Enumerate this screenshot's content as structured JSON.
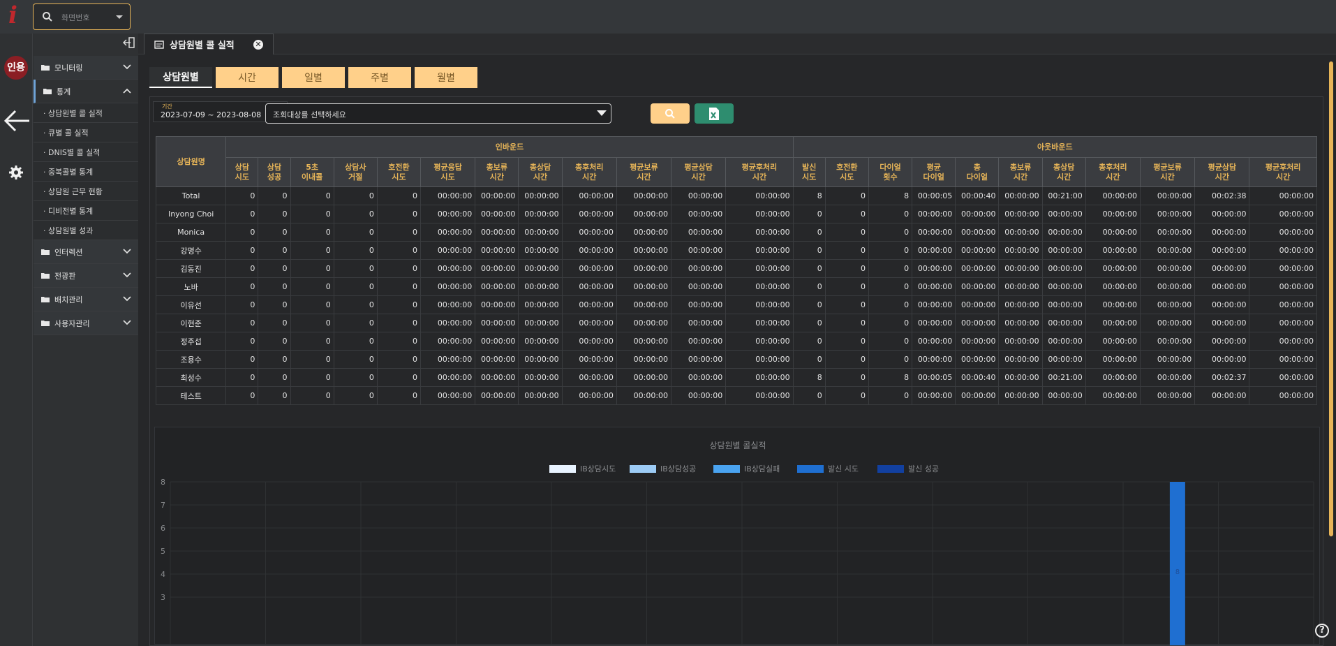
{
  "app": {
    "logo_text": "i",
    "search_placeholder": "화면번호"
  },
  "rail": {
    "avatar_text": "인용"
  },
  "sidebar": {
    "groups": [
      {
        "label": "모니터링",
        "open": false
      },
      {
        "label": "통계",
        "open": true,
        "items": [
          "· 상담원별 콜 실적",
          "· 큐별 콜 실적",
          "· DNIS별 콜 실적",
          "· 중복콜별 통계",
          "· 상담원 근무 현황",
          "· 디비전별 통계",
          "· 상담원별 성과"
        ]
      },
      {
        "label": "인터렉션",
        "open": false
      },
      {
        "label": "전광판",
        "open": false
      },
      {
        "label": "배치관리",
        "open": false
      },
      {
        "label": "사용자관리",
        "open": false
      }
    ]
  },
  "page_tab": {
    "label": "상담원별 콜 실적",
    "close": "✕"
  },
  "sub_tabs": [
    "상담원별",
    "시간",
    "일별",
    "주별",
    "월별"
  ],
  "filters": {
    "period_label": "기간",
    "period_value": "2023-07-09  ~  2023-08-08",
    "target_placeholder": "조회대상를 선택하세요"
  },
  "table": {
    "name_header": "상담원명",
    "inbound_header": "인바운드",
    "outbound_header": "아웃바운드",
    "inbound_cols": [
      "상담\n시도",
      "상담\n성공",
      "5초\n이내콜",
      "상담사\n거절",
      "호전환\n시도",
      "평균응답\n시도",
      "총보류\n시간",
      "총상담\n시간",
      "총후처리\n시간",
      "평균보류\n시간",
      "평균상담\n시간",
      "평균후처리\n시간"
    ],
    "outbound_cols": [
      "발신\n시도",
      "호전환\n시도",
      "다이얼\n횟수",
      "평균\n다이얼",
      "총\n다이얼",
      "총보류\n시간",
      "총상담\n시간",
      "총후처리\n시간",
      "평균보류\n시간",
      "평균상담\n시간",
      "평균후처리\n시간"
    ],
    "rows": [
      {
        "name": "Total",
        "values": [
          "0",
          "0",
          "0",
          "0",
          "0",
          "00:00:00",
          "00:00:00",
          "00:00:00",
          "00:00:00",
          "00:00:00",
          "00:00:00",
          "00:00:00",
          "8",
          "0",
          "8",
          "00:00:05",
          "00:00:40",
          "00:00:00",
          "00:21:00",
          "00:00:00",
          "00:00:00",
          "00:02:38",
          "00:00:00"
        ]
      },
      {
        "name": "Inyong Choi",
        "values": [
          "0",
          "0",
          "0",
          "0",
          "0",
          "00:00:00",
          "00:00:00",
          "00:00:00",
          "00:00:00",
          "00:00:00",
          "00:00:00",
          "00:00:00",
          "0",
          "0",
          "0",
          "00:00:00",
          "00:00:00",
          "00:00:00",
          "00:00:00",
          "00:00:00",
          "00:00:00",
          "00:00:00",
          "00:00:00"
        ]
      },
      {
        "name": "Monica",
        "values": [
          "0",
          "0",
          "0",
          "0",
          "0",
          "00:00:00",
          "00:00:00",
          "00:00:00",
          "00:00:00",
          "00:00:00",
          "00:00:00",
          "00:00:00",
          "0",
          "0",
          "0",
          "00:00:00",
          "00:00:00",
          "00:00:00",
          "00:00:00",
          "00:00:00",
          "00:00:00",
          "00:00:00",
          "00:00:00"
        ]
      },
      {
        "name": "강명수",
        "values": [
          "0",
          "0",
          "0",
          "0",
          "0",
          "00:00:00",
          "00:00:00",
          "00:00:00",
          "00:00:00",
          "00:00:00",
          "00:00:00",
          "00:00:00",
          "0",
          "0",
          "0",
          "00:00:00",
          "00:00:00",
          "00:00:00",
          "00:00:00",
          "00:00:00",
          "00:00:00",
          "00:00:00",
          "00:00:00"
        ]
      },
      {
        "name": "김동진",
        "values": [
          "0",
          "0",
          "0",
          "0",
          "0",
          "00:00:00",
          "00:00:00",
          "00:00:00",
          "00:00:00",
          "00:00:00",
          "00:00:00",
          "00:00:00",
          "0",
          "0",
          "0",
          "00:00:00",
          "00:00:00",
          "00:00:00",
          "00:00:00",
          "00:00:00",
          "00:00:00",
          "00:00:00",
          "00:00:00"
        ]
      },
      {
        "name": "노바",
        "values": [
          "0",
          "0",
          "0",
          "0",
          "0",
          "00:00:00",
          "00:00:00",
          "00:00:00",
          "00:00:00",
          "00:00:00",
          "00:00:00",
          "00:00:00",
          "0",
          "0",
          "0",
          "00:00:00",
          "00:00:00",
          "00:00:00",
          "00:00:00",
          "00:00:00",
          "00:00:00",
          "00:00:00",
          "00:00:00"
        ]
      },
      {
        "name": "이유선",
        "values": [
          "0",
          "0",
          "0",
          "0",
          "0",
          "00:00:00",
          "00:00:00",
          "00:00:00",
          "00:00:00",
          "00:00:00",
          "00:00:00",
          "00:00:00",
          "0",
          "0",
          "0",
          "00:00:00",
          "00:00:00",
          "00:00:00",
          "00:00:00",
          "00:00:00",
          "00:00:00",
          "00:00:00",
          "00:00:00"
        ]
      },
      {
        "name": "이현준",
        "values": [
          "0",
          "0",
          "0",
          "0",
          "0",
          "00:00:00",
          "00:00:00",
          "00:00:00",
          "00:00:00",
          "00:00:00",
          "00:00:00",
          "00:00:00",
          "0",
          "0",
          "0",
          "00:00:00",
          "00:00:00",
          "00:00:00",
          "00:00:00",
          "00:00:00",
          "00:00:00",
          "00:00:00",
          "00:00:00"
        ]
      },
      {
        "name": "정주섭",
        "values": [
          "0",
          "0",
          "0",
          "0",
          "0",
          "00:00:00",
          "00:00:00",
          "00:00:00",
          "00:00:00",
          "00:00:00",
          "00:00:00",
          "00:00:00",
          "0",
          "0",
          "0",
          "00:00:00",
          "00:00:00",
          "00:00:00",
          "00:00:00",
          "00:00:00",
          "00:00:00",
          "00:00:00",
          "00:00:00"
        ]
      },
      {
        "name": "조용수",
        "values": [
          "0",
          "0",
          "0",
          "0",
          "0",
          "00:00:00",
          "00:00:00",
          "00:00:00",
          "00:00:00",
          "00:00:00",
          "00:00:00",
          "00:00:00",
          "0",
          "0",
          "0",
          "00:00:00",
          "00:00:00",
          "00:00:00",
          "00:00:00",
          "00:00:00",
          "00:00:00",
          "00:00:00",
          "00:00:00"
        ]
      },
      {
        "name": "최성수",
        "values": [
          "0",
          "0",
          "0",
          "0",
          "0",
          "00:00:00",
          "00:00:00",
          "00:00:00",
          "00:00:00",
          "00:00:00",
          "00:00:00",
          "00:00:00",
          "8",
          "0",
          "8",
          "00:00:05",
          "00:00:40",
          "00:00:00",
          "00:21:00",
          "00:00:00",
          "00:00:00",
          "00:02:37",
          "00:00:00"
        ]
      },
      {
        "name": "테스트",
        "values": [
          "0",
          "0",
          "0",
          "0",
          "0",
          "00:00:00",
          "00:00:00",
          "00:00:00",
          "00:00:00",
          "00:00:00",
          "00:00:00",
          "00:00:00",
          "0",
          "0",
          "0",
          "00:00:00",
          "00:00:00",
          "00:00:00",
          "00:00:00",
          "00:00:00",
          "00:00:00",
          "00:00:00",
          "00:00:00"
        ]
      }
    ]
  },
  "chart_data": {
    "type": "bar",
    "title": "상담원별 콜실적",
    "categories": [
      "Total",
      "Inyong Choi",
      "Monica",
      "강명수",
      "김동진",
      "노바",
      "이유선",
      "이현준",
      "정주섭",
      "조용수",
      "최성수",
      "테스트"
    ],
    "series": [
      {
        "name": "IB상담시도",
        "color": "#e8f3ff",
        "values": [
          0,
          0,
          0,
          0,
          0,
          0,
          0,
          0,
          0,
          0,
          0,
          0
        ]
      },
      {
        "name": "IB상담성공",
        "color": "#9ccbf5",
        "values": [
          0,
          0,
          0,
          0,
          0,
          0,
          0,
          0,
          0,
          0,
          0,
          0
        ]
      },
      {
        "name": "IB상담실패",
        "color": "#4aa3f0",
        "values": [
          0,
          0,
          0,
          0,
          0,
          0,
          0,
          0,
          0,
          0,
          0,
          0
        ]
      },
      {
        "name": "발신 시도",
        "color": "#1f6fd1",
        "values": [
          0,
          0,
          0,
          0,
          0,
          0,
          0,
          0,
          0,
          0,
          8,
          0
        ]
      },
      {
        "name": "발신 성공",
        "color": "#1240a0",
        "values": [
          0,
          0,
          0,
          0,
          0,
          0,
          0,
          0,
          0,
          0,
          0,
          0
        ]
      }
    ],
    "yticks": [
      "8",
      "7",
      "6",
      "5",
      "4",
      "3"
    ],
    "ylim": [
      0,
      8
    ],
    "legend": "top-center",
    "bar_label": "8"
  }
}
